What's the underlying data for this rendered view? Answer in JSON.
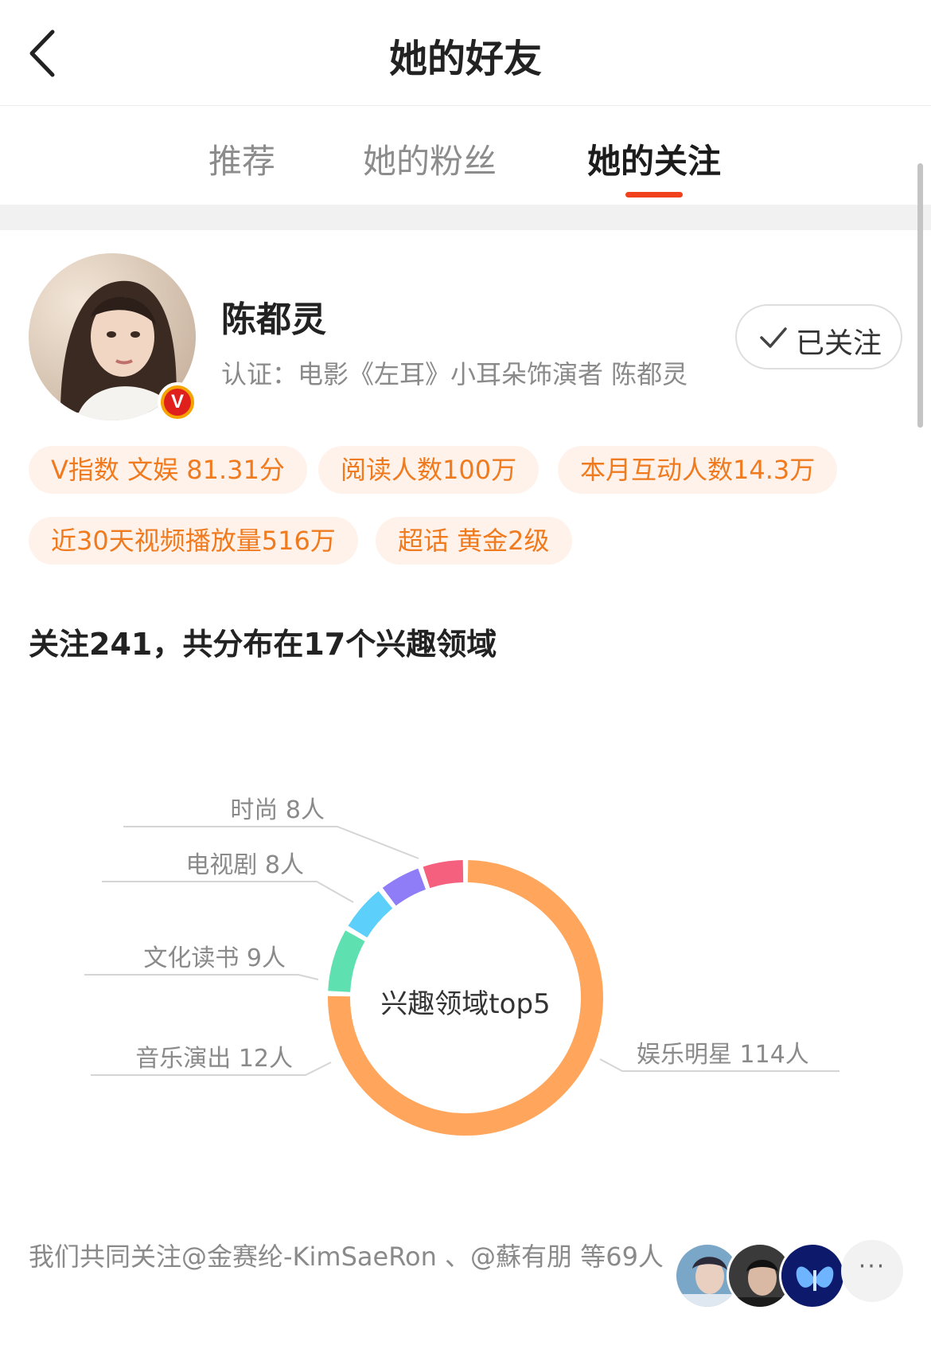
{
  "nav": {
    "title": "她的好友"
  },
  "tabs": [
    {
      "label": "推荐"
    },
    {
      "label": "她的粉丝"
    },
    {
      "label": "她的关注"
    }
  ],
  "profile": {
    "name": "陈都灵",
    "certification": "认证：电影《左耳》小耳朵饰演者 陈都灵",
    "verified_badge": "V",
    "follow_label": "已关注"
  },
  "tags": [
    "V指数 文娱 81.31分",
    "阅读人数100万",
    "本月互动人数14.3万",
    "近30天视频播放量516万",
    "超话 黄金2级"
  ],
  "summary": "关注241，共分布在17个兴趣领域",
  "chart_data": {
    "type": "pie",
    "title": "兴趣领域top5",
    "slices": [
      {
        "label": "娱乐明星 114人",
        "value": 114,
        "color": "#ffa65c"
      },
      {
        "label": "音乐演出 12人",
        "value": 12,
        "color": "#5fe0b0"
      },
      {
        "label": "文化读书 9人",
        "value": 9,
        "color": "#5ccffa"
      },
      {
        "label": "电视剧 8人",
        "value": 8,
        "color": "#8f7cf7"
      },
      {
        "label": "时尚 8人",
        "value": 8,
        "color": "#f4607e"
      }
    ]
  },
  "common_follow": {
    "text": "我们共同关注@金赛纶-KimSaeRon 、@蘇有朋 等69人",
    "more_icon": "···"
  },
  "icons": {
    "back": "chevron-left-icon",
    "check": "check-icon",
    "more": "more-icon"
  }
}
